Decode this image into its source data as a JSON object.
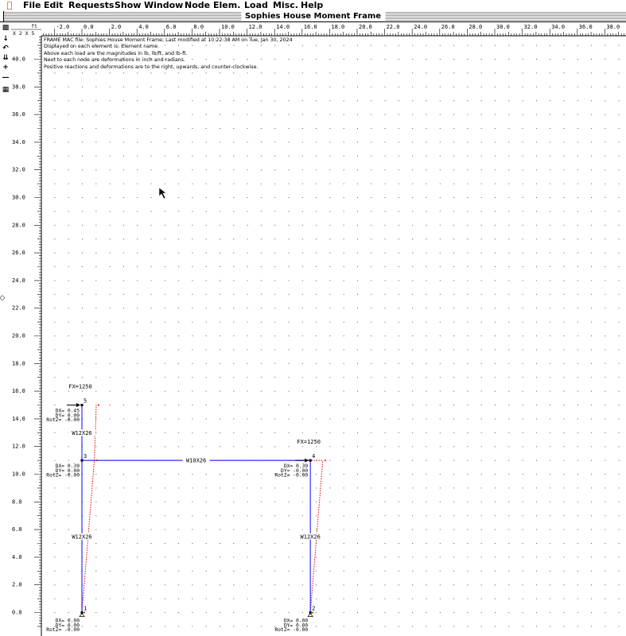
{
  "menubar": {
    "apple_icon": "apple-menu-icon",
    "items": [
      "File",
      "Edit",
      "Requests",
      "Show",
      "Window",
      "Node",
      "Elem.",
      "Load",
      "Misc.",
      "Help"
    ]
  },
  "window": {
    "title": "Sophies House Moment Frame"
  },
  "ruler": {
    "unit": "ft",
    "zoom_label": "X 2 X 5",
    "x_ticks": [
      "-2.0",
      "0.0",
      "2.0",
      "4.0",
      "6.0",
      "8.0",
      "10.0",
      "12.0",
      "14.0",
      "16.0",
      "18.0",
      "20.0",
      "22.0",
      "24.0",
      "26.0",
      "28.0",
      "30.0",
      "32.0",
      "34.0",
      "36.0",
      "38.0"
    ],
    "y_ticks": [
      "40.0",
      "38.0",
      "36.0",
      "34.0",
      "32.0",
      "30.0",
      "28.0",
      "26.0",
      "24.0",
      "22.0",
      "20.0",
      "18.0",
      "16.0",
      "14.0",
      "12.0",
      "10.0",
      "8.0",
      "6.0",
      "4.0",
      "2.0",
      "0.0"
    ]
  },
  "notes": [
    "FRAME MAC file:  Sophies House Moment Frame; Last modified at 10:22:38 AM on Tue, Jan 30, 2024",
    "Displayed on each element is: Element name.",
    "Above each load are the magnitudes in lb, lb/ft, and lb-ft.",
    "Next to each node are deformations in inch and radians.",
    "Positive reactions and deformations are to the right, upwards, and counter-clockwise."
  ],
  "frame": {
    "nodes": [
      {
        "id": "1",
        "x": 0,
        "y": 0,
        "defl": [
          "DX= 0.00",
          "DY= 0.00",
          "RotZ= -0.00"
        ]
      },
      {
        "id": "2",
        "x": 16.6,
        "y": 0,
        "defl": [
          "DX= 0.00",
          "DY= 0.00",
          "RotZ= -0.00"
        ]
      },
      {
        "id": "3",
        "x": 0,
        "y": 11,
        "defl": [
          "DX= 0.39",
          "DY= 0.00",
          "RotZ= -0.00"
        ]
      },
      {
        "id": "4",
        "x": 16.6,
        "y": 11,
        "defl": [
          "DX= 0.39",
          "DY= -0.00",
          "RotZ= -0.00"
        ]
      },
      {
        "id": "5",
        "x": 0,
        "y": 15,
        "defl": [
          "DX= 0.45",
          "DY= 0.00",
          "RotZ= -0.00"
        ]
      }
    ],
    "elements": [
      {
        "name": "W12X26",
        "from": "1",
        "to": "3"
      },
      {
        "name": "W12X26",
        "from": "3",
        "to": "5"
      },
      {
        "name": "W10X26",
        "from": "3",
        "to": "4"
      },
      {
        "name": "W12X26",
        "from": "2",
        "to": "4"
      }
    ],
    "loads": [
      {
        "label": "FX=1250",
        "node": "5"
      },
      {
        "label": "FX=1250",
        "node": "4"
      }
    ],
    "colors": {
      "member": "#3030ff",
      "deflected": "#e00000",
      "grid": "#555555"
    }
  }
}
